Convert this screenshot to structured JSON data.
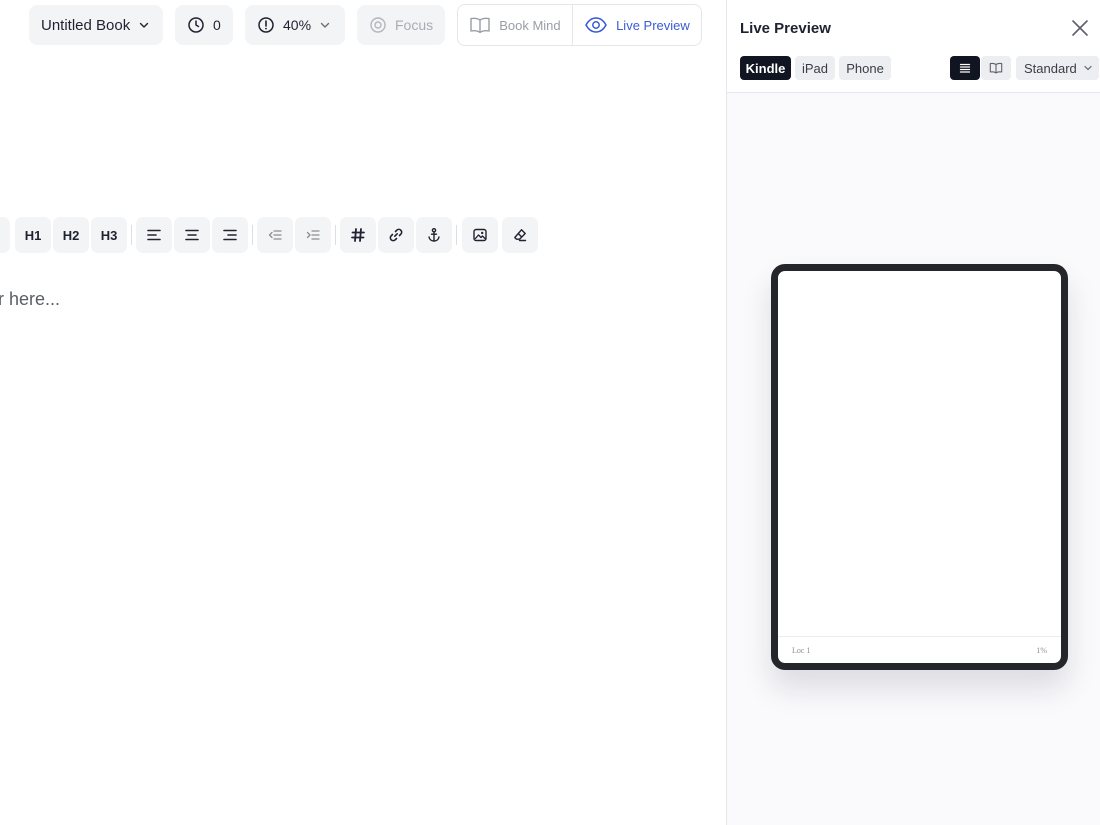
{
  "toolbar": {
    "book_title": "Untitled Book",
    "timer_value": "0",
    "goal_value": "40%",
    "focus_label": "Focus",
    "book_mind_label": "Book Mind",
    "live_preview_label": "Live Preview",
    "accent_color": "#3b5bd6",
    "icons": [
      "chevron-down-icon",
      "clock-icon",
      "alert-circle-icon",
      "focus-target-icon",
      "book-open-icon",
      "eye-icon"
    ]
  },
  "format_toolbar": {
    "h1": "H1",
    "h2": "H2",
    "h3": "H3",
    "icons": [
      "align-left-icon",
      "align-center-icon",
      "align-right-icon",
      "outdent-icon",
      "indent-icon",
      "hashtag-icon",
      "link-icon",
      "anchor-icon",
      "image-icon",
      "eraser-icon"
    ]
  },
  "editor": {
    "placeholder_fragment": "r here..."
  },
  "preview_panel": {
    "title": "Live Preview",
    "devices": [
      "Kindle",
      "iPad",
      "Phone"
    ],
    "active_device": "Kindle",
    "view_modes": [
      "list-icon",
      "book-open-icon"
    ],
    "style_select_value": "Standard",
    "device_footer": {
      "location": "Loc 1",
      "percent": "1%"
    }
  }
}
